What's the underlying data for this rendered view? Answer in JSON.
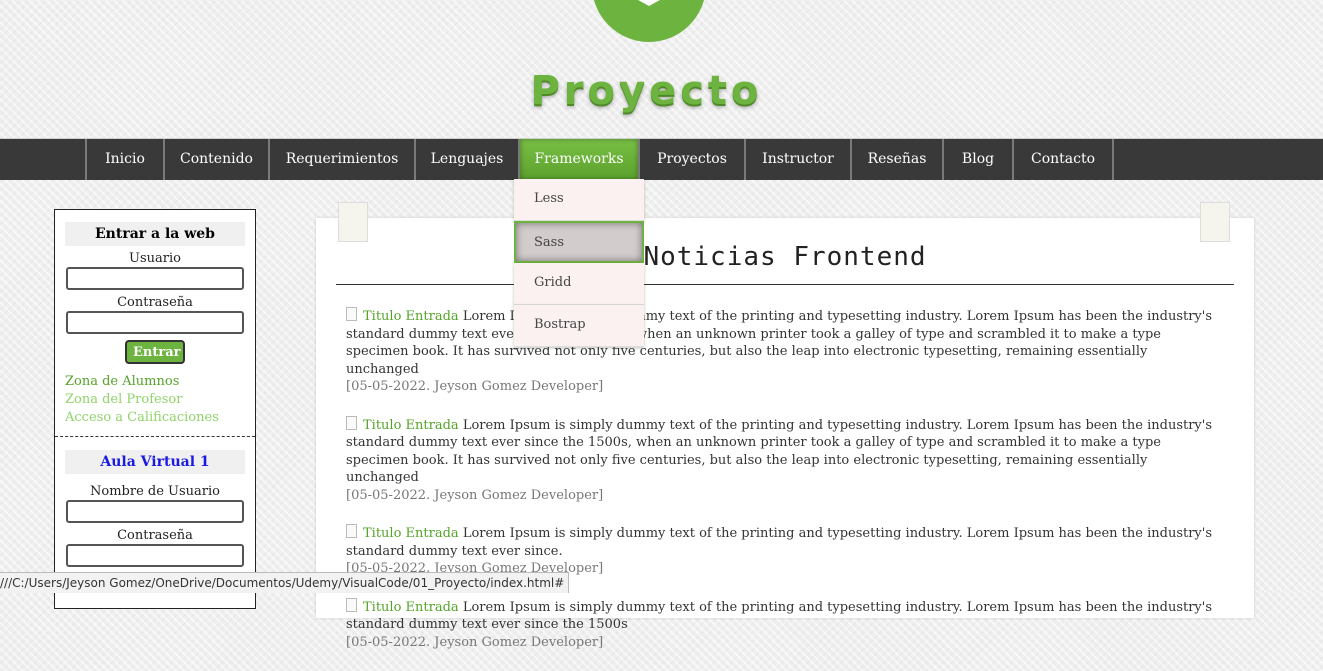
{
  "header": {
    "site_title": "Proyecto",
    "brand_color": "#6db33f"
  },
  "nav": {
    "items": [
      {
        "label": "Inicio"
      },
      {
        "label": "Contenido"
      },
      {
        "label": "Requerimientos"
      },
      {
        "label": "Lenguajes"
      },
      {
        "label": "Frameworks",
        "active": true
      },
      {
        "label": "Proyectos"
      },
      {
        "label": "Instructor"
      },
      {
        "label": "Reseñas"
      },
      {
        "label": "Blog"
      },
      {
        "label": "Contacto"
      }
    ],
    "dropdown": [
      "Less",
      "Sass",
      "Gridd",
      "Bostrap"
    ],
    "dropdown_hovered": "Sass"
  },
  "sidebar": {
    "login_title": "Entrar a la web",
    "user_label": "Usuario",
    "password_label": "Contraseña",
    "submit_label": "Entrar",
    "links": [
      {
        "label": "Zona de Alumnos",
        "color": "#55a32a"
      },
      {
        "label": "Zona del Profesor",
        "color": "#8fd36a"
      },
      {
        "label": "Acceso a Calificaciones",
        "color": "#8fd36a"
      }
    ],
    "aula_title": "Aula Virtual 1",
    "aula_user_label": "Nombre de Usuario",
    "aula_password_label": "Contraseña"
  },
  "main": {
    "title": "Noticias Frontend",
    "entries": [
      {
        "title": "Titulo Entrada",
        "text": "Lorem Ipsum is simply dummy text of the printing and typesetting industry. Lorem Ipsum has been the industry's standard dummy text ever since the 1500s, when an unknown printer took a galley of type and scrambled it to make a type specimen book. It has survived not only five centuries, but also the leap into electronic typesetting, remaining essentially unchanged",
        "meta": "[05-05-2022. Jeyson Gomez Developer]"
      },
      {
        "title": "Titulo Entrada",
        "text": "Lorem Ipsum is simply dummy text of the printing and typesetting industry. Lorem Ipsum has been the industry's standard dummy text ever since the 1500s, when an unknown printer took a galley of type and scrambled it to make a type specimen book. It has survived not only five centuries, but also the leap into electronic typesetting, remaining essentially unchanged",
        "meta": "[05-05-2022. Jeyson Gomez Developer]"
      },
      {
        "title": "Titulo Entrada",
        "text": "Lorem Ipsum is simply dummy text of the printing and typesetting industry. Lorem Ipsum has been the industry's standard dummy text ever since.",
        "meta": "[05-05-2022. Jeyson Gomez Developer]"
      },
      {
        "title": "Titulo Entrada",
        "text": "Lorem Ipsum is simply dummy text of the printing and typesetting industry. Lorem Ipsum has been the industry's standard dummy text ever since the 1500s",
        "meta": "[05-05-2022. Jeyson Gomez Developer]"
      }
    ]
  },
  "status_bar": {
    "url": "///C:/Users/Jeyson Gomez/OneDrive/Documentos/Udemy/VisualCode/01_Proyecto/index.html#"
  }
}
